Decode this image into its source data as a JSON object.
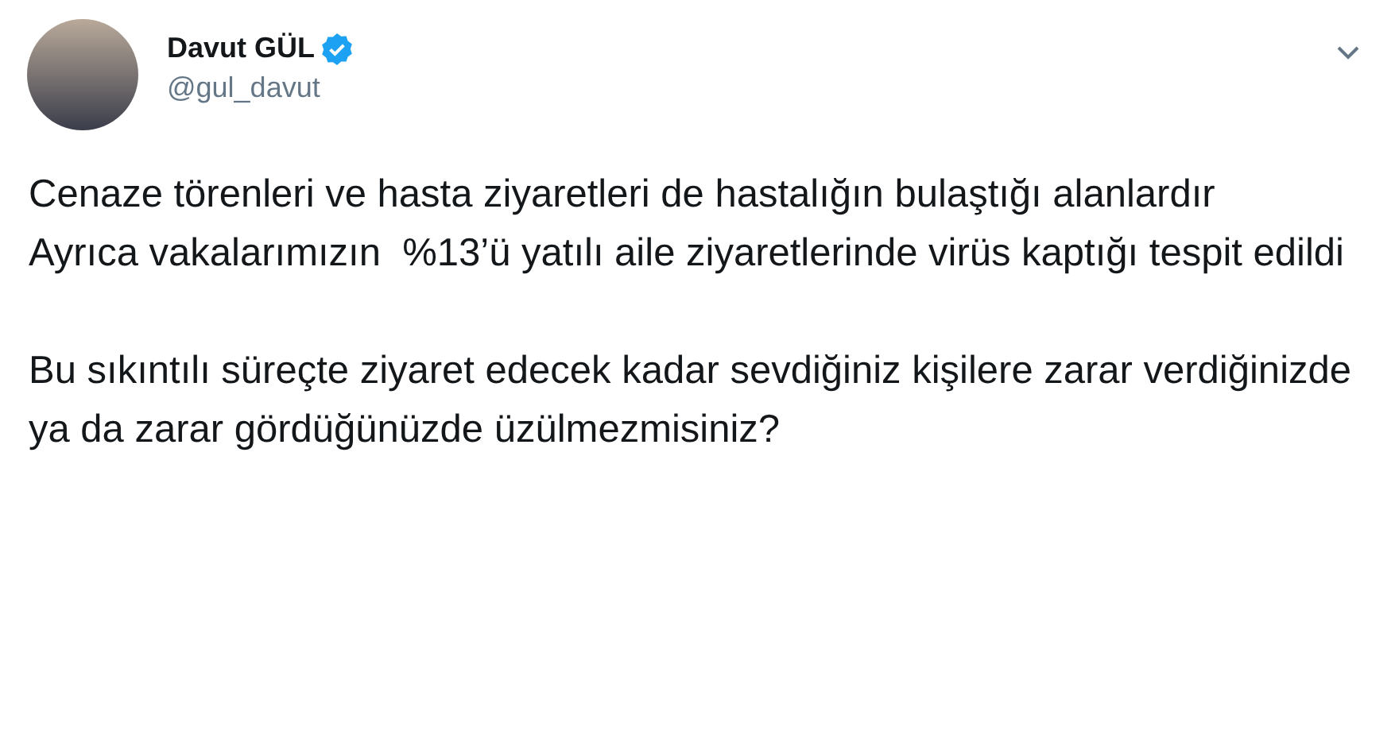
{
  "author": {
    "name": "Davut GÜL",
    "verified": true,
    "handle": "@gul_davut"
  },
  "body": [
    [
      "Cenaze törenleri ve hasta ziyaretleri de hastalığın bulaştığı alanlardır",
      "Ayrıca vakalarımızın  %13’ü yatılı aile ziyaretlerinde virüs kaptığı tespit edildi"
    ],
    [
      "Bu sıkıntılı süreçte ziyaret edecek kadar sevdiğiniz kişilere zarar verdiğinizde ya da zarar gördüğünüzde üzülmezmisiniz?"
    ]
  ]
}
